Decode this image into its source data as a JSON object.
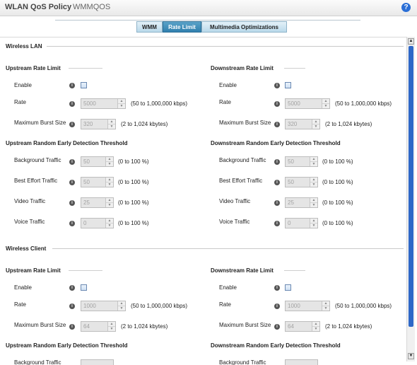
{
  "header": {
    "title": "WLAN QoS Policy",
    "policy_name": "WMMQOS",
    "help_icon": "?"
  },
  "tabs": [
    {
      "label": "WMM",
      "active": false
    },
    {
      "label": "Rate Limit",
      "active": true
    },
    {
      "label": "Multimedia Optimizations",
      "active": false
    }
  ],
  "sections": {
    "wireless_lan": {
      "title": "Wireless LAN",
      "upstream_rate": {
        "title": "Upstream Rate Limit",
        "enable_label": "Enable",
        "rate_label": "Rate",
        "rate_value": "5000",
        "rate_hint": "(50 to 1,000,000 kbps)",
        "burst_label": "Maximum Burst Size",
        "burst_value": "320",
        "burst_hint": "(2 to 1,024 kbytes)"
      },
      "downstream_rate": {
        "title": "Downstream Rate Limit",
        "enable_label": "Enable",
        "rate_label": "Rate",
        "rate_value": "5000",
        "rate_hint": "(50 to 1,000,000 kbps)",
        "burst_label": "Maximum Burst Size",
        "burst_value": "320",
        "burst_hint": "(2 to 1,024 kbytes)"
      },
      "upstream_red": {
        "title": "Upstream Random Early Detection Threshold",
        "background_label": "Background Traffic",
        "background_value": "50",
        "background_hint": "(0 to 100 %)",
        "best_effort_label": "Best Effort Traffic",
        "best_effort_value": "50",
        "best_effort_hint": "(0 to 100 %)",
        "video_label": "Video Traffic",
        "video_value": "25",
        "video_hint": "(0 to 100 %)",
        "voice_label": "Voice Traffic",
        "voice_value": "0",
        "voice_hint": "(0 to 100 %)"
      },
      "downstream_red": {
        "title": "Downstream Random Early Detection Threshold",
        "background_label": "Background Traffic",
        "background_value": "50",
        "background_hint": "(0 to 100 %)",
        "best_effort_label": "Best Effort Traffic",
        "best_effort_value": "50",
        "best_effort_hint": "(0 to 100 %)",
        "video_label": "Video Traffic",
        "video_value": "25",
        "video_hint": "(0 to 100 %)",
        "voice_label": "Voice Traffic",
        "voice_value": "0",
        "voice_hint": "(0 to 100 %)"
      }
    },
    "wireless_client": {
      "title": "Wireless Client",
      "upstream_rate": {
        "title": "Upstream Rate Limit",
        "enable_label": "Enable",
        "rate_label": "Rate",
        "rate_value": "1000",
        "rate_hint": "(50 to 1,000,000 kbps)",
        "burst_label": "Maximum Burst Size",
        "burst_value": "64",
        "burst_hint": "(2 to 1,024 kbytes)"
      },
      "downstream_rate": {
        "title": "Downstream Rate Limit",
        "enable_label": "Enable",
        "rate_label": "Rate",
        "rate_value": "1000",
        "rate_hint": "(50 to 1,000,000 kbps)",
        "burst_label": "Maximum Burst Size",
        "burst_value": "64",
        "burst_hint": "(2 to 1,024 kbytes)"
      },
      "upstream_red_title": "Upstream Random Early Detection Threshold",
      "downstream_red_title": "Downstream Random Early Detection Threshold",
      "partial_label": "Background Traffic"
    }
  },
  "colors": {
    "active_tab": "#2f7fae",
    "tab": "#cfe6f3",
    "scroll_thumb": "#2f68c7",
    "help": "#2b6fd6"
  }
}
